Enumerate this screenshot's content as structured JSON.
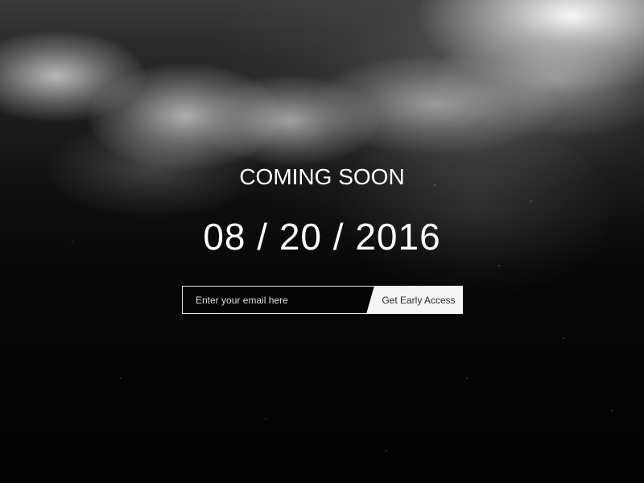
{
  "hero": {
    "heading": "COMING SOON",
    "launch_date": "08 / 20 / 2016"
  },
  "signup": {
    "email_placeholder": "Enter your email here",
    "email_value": "",
    "button_label": "Get Early Access"
  },
  "colors": {
    "text": "#ffffff",
    "button_background": "#f4f4f4",
    "button_text": "#2a2a2a",
    "input_border": "#e8e8e8"
  }
}
